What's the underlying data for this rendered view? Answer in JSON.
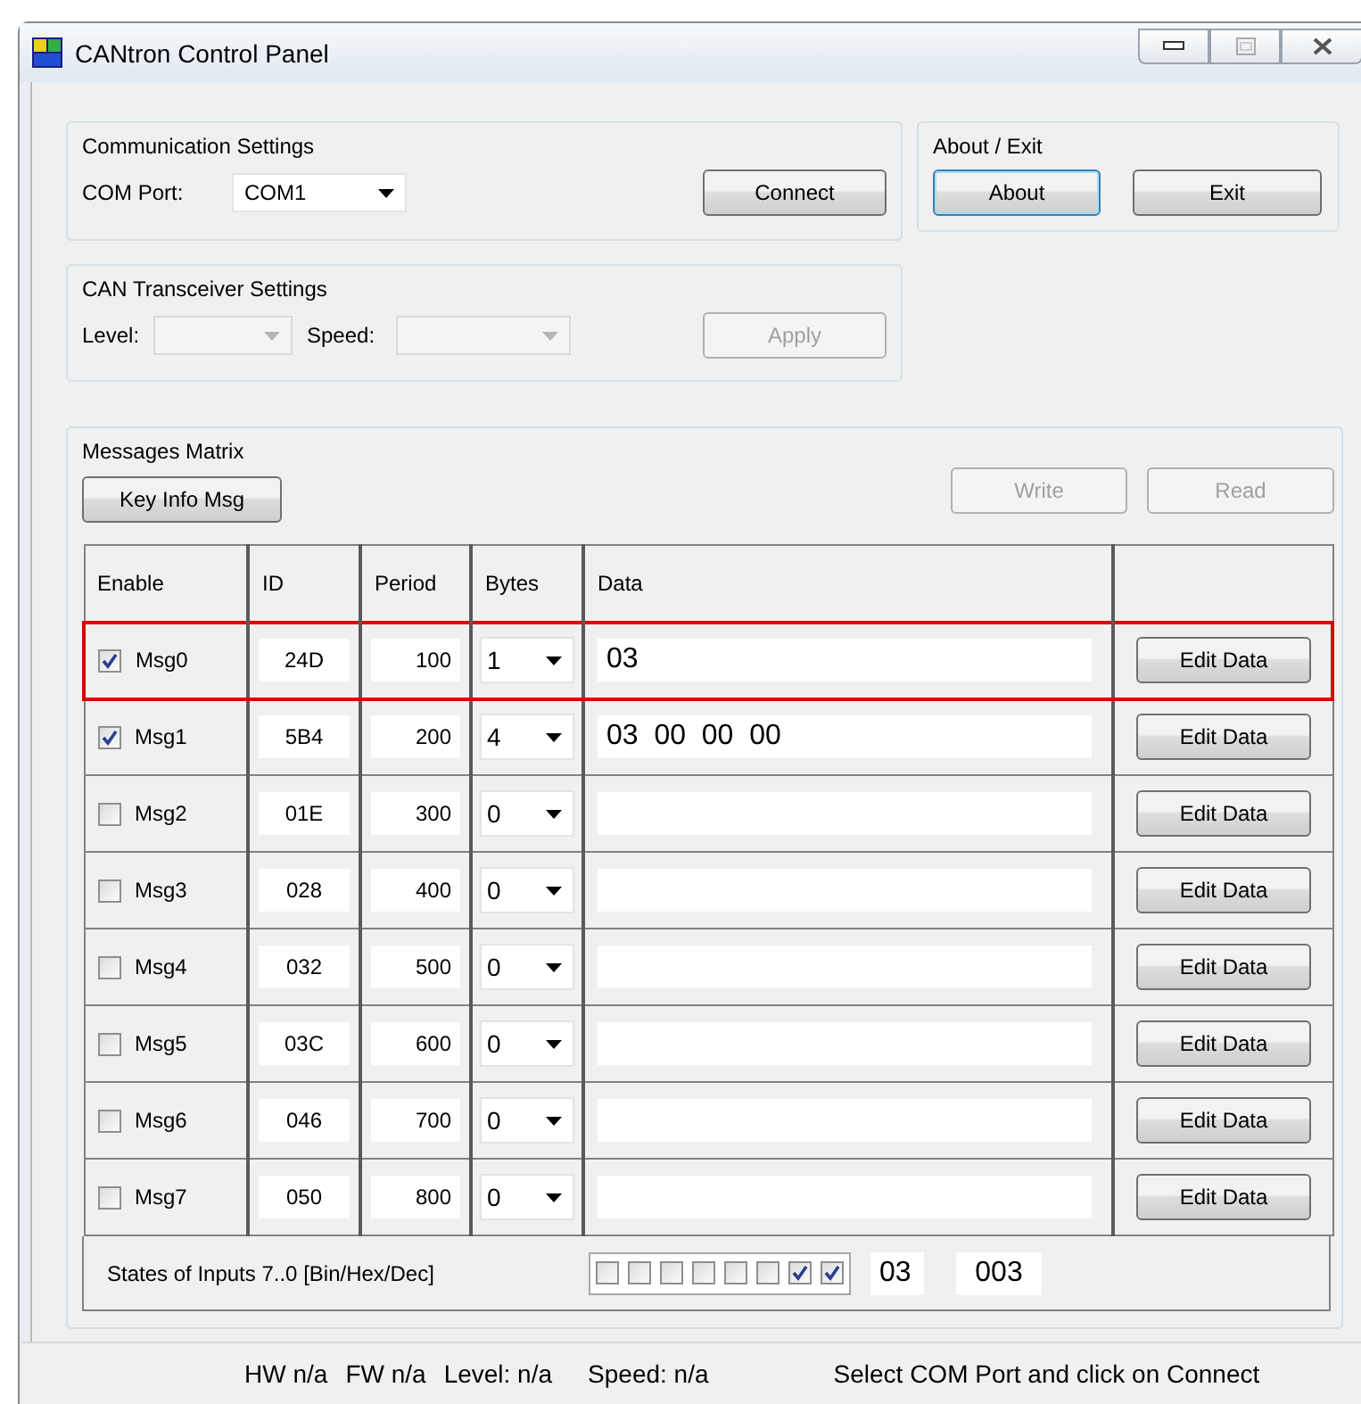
{
  "window": {
    "title": "CANtron Control Panel"
  },
  "communication_settings": {
    "title": "Communication Settings",
    "com_port_label": "COM Port:",
    "com_port": "COM1",
    "connect": {
      "label": "Connect",
      "disabled": false,
      "focused": false
    }
  },
  "about_exit": {
    "title": "About / Exit",
    "buttons": [
      {
        "label": "About",
        "disabled": false,
        "focused": true
      },
      {
        "label": "Exit",
        "disabled": false,
        "focused": false
      }
    ]
  },
  "can_transceiver_settings": {
    "title": "CAN Transceiver Settings",
    "level_label": "Level:",
    "level_disabled": true,
    "speed_label": "Speed:",
    "speed_disabled": true,
    "apply": {
      "label": "Apply",
      "disabled": true,
      "focused": false
    }
  },
  "messages_matrix": {
    "title": "Messages Matrix",
    "key_info": {
      "label": "Key Info Msg",
      "disabled": false,
      "focused": false
    },
    "write": {
      "label": "Write",
      "disabled": true,
      "focused": false
    },
    "read": {
      "label": "Read",
      "disabled": true,
      "focused": false
    },
    "table": {
      "columns": [
        "Enable",
        "ID",
        "Period",
        "Bytes",
        "Data"
      ],
      "rows": [
        {
          "name": "Msg0",
          "enabled": true,
          "id": "24D",
          "period": "100",
          "bytes": "1",
          "data": "03",
          "button": "Edit Data",
          "selected": true
        },
        {
          "name": "Msg1",
          "enabled": true,
          "id": "5B4",
          "period": "200",
          "bytes": "4",
          "data": "03  00  00  00",
          "button": "Edit Data",
          "selected": false
        },
        {
          "name": "Msg2",
          "enabled": false,
          "id": "01E",
          "period": "300",
          "bytes": "0",
          "button": "Edit Data",
          "selected": false
        },
        {
          "name": "Msg3",
          "enabled": false,
          "id": "028",
          "period": "400",
          "bytes": "0",
          "button": "Edit Data",
          "selected": false
        },
        {
          "name": "Msg4",
          "enabled": false,
          "id": "032",
          "period": "500",
          "bytes": "0",
          "button": "Edit Data",
          "selected": false
        },
        {
          "name": "Msg5",
          "enabled": false,
          "id": "03C",
          "period": "600",
          "bytes": "0",
          "button": "Edit Data",
          "selected": false
        },
        {
          "name": "Msg6",
          "enabled": false,
          "id": "046",
          "period": "700",
          "bytes": "0",
          "button": "Edit Data",
          "selected": false
        },
        {
          "name": "Msg7",
          "enabled": false,
          "id": "050",
          "period": "800",
          "bytes": "0",
          "button": "Edit Data",
          "selected": false
        }
      ]
    },
    "inputs": {
      "label": "States of Inputs 7..0 [Bin/Hex/Dec]",
      "bits": [
        false,
        false,
        false,
        false,
        false,
        false,
        true,
        true
      ],
      "hex": "03",
      "dec": "003"
    }
  },
  "status_bar": {
    "items": [
      "HW n/a",
      "FW n/a",
      "Level: n/a",
      "Speed: n/a"
    ],
    "message": "Select COM Port and click on Connect"
  }
}
